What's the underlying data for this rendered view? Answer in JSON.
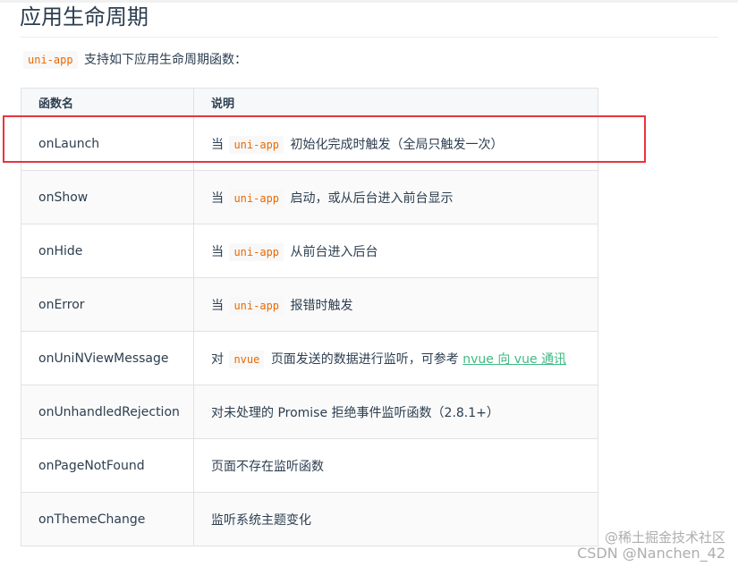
{
  "heading": "应用生命周期",
  "intro": {
    "code": "uni-app",
    "text": "支持如下应用生命周期函数："
  },
  "table": {
    "headers": [
      "函数名",
      "说明"
    ],
    "rows": [
      {
        "name": "onLaunch",
        "desc_pre": "当",
        "desc_code": "uni-app",
        "desc_post": "初始化完成时触发（全局只触发一次）"
      },
      {
        "name": "onShow",
        "desc_pre": "当",
        "desc_code": "uni-app",
        "desc_post": "启动，或从后台进入前台显示"
      },
      {
        "name": "onHide",
        "desc_pre": "当",
        "desc_code": "uni-app",
        "desc_post": "从前台进入后台"
      },
      {
        "name": "onError",
        "desc_pre": "当",
        "desc_code": "uni-app",
        "desc_post": "报错时触发"
      },
      {
        "name": "onUniNViewMessage",
        "desc_pre": "对",
        "desc_code": "nvue",
        "desc_post": "页面发送的数据进行监听，可参考",
        "desc_link": "nvue 向 vue 通讯"
      },
      {
        "name": "onUnhandledRejection",
        "desc_text": "对未处理的 Promise 拒绝事件监听函数（2.8.1+）"
      },
      {
        "name": "onPageNotFound",
        "desc_text": "页面不存在监听函数"
      },
      {
        "name": "onThemeChange",
        "desc_text": "监听系统主题变化"
      }
    ]
  },
  "watermark": {
    "line1": "@稀土掘金技术社区",
    "line2": "CSDN @Nanchen_42"
  },
  "colors": {
    "code_text": "#e96900",
    "link": "#42b983",
    "highlight_border": "#e8343e"
  }
}
